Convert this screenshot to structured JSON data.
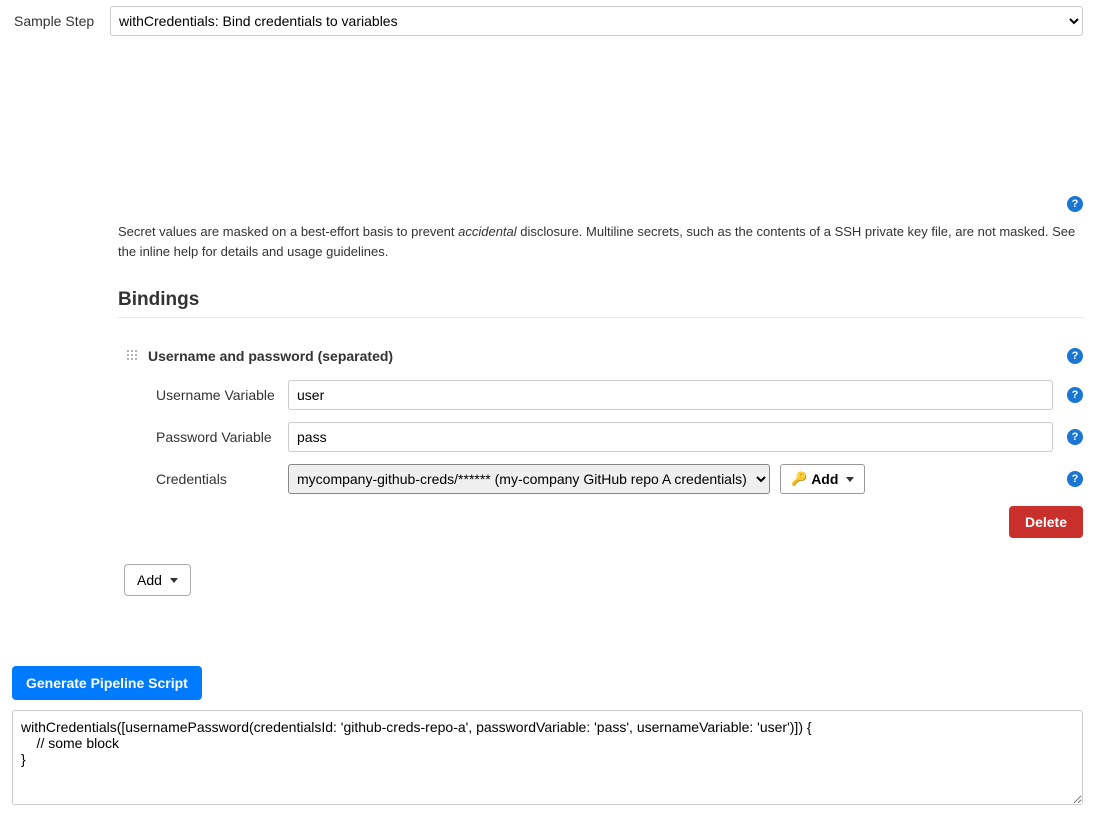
{
  "sample_step": {
    "label": "Sample Step",
    "selected": "withCredentials: Bind credentials to variables"
  },
  "desc": {
    "part1": "Secret values are masked on a best-effort basis to prevent ",
    "accidental": "accidental",
    "part2": " disclosure. Multiline secrets, such as the contents of a SSH private key file, are not masked. See the inline help for details and usage guidelines."
  },
  "section_bindings": "Bindings",
  "binding": {
    "title": "Username and password (separated)",
    "username_var": {
      "label": "Username Variable",
      "value": "user"
    },
    "password_var": {
      "label": "Password Variable",
      "value": "pass"
    },
    "credentials": {
      "label": "Credentials",
      "selected": "mycompany-github-creds/****** (my-company GitHub repo A credentials)",
      "add_label": "Add"
    },
    "delete_label": "Delete"
  },
  "add_binding_label": "Add",
  "generate_label": "Generate Pipeline Script",
  "script_output": "withCredentials([usernamePassword(credentialsId: 'github-creds-repo-a', passwordVariable: 'pass', usernameVariable: 'user')]) {\n    // some block\n}",
  "help_glyph": "?"
}
